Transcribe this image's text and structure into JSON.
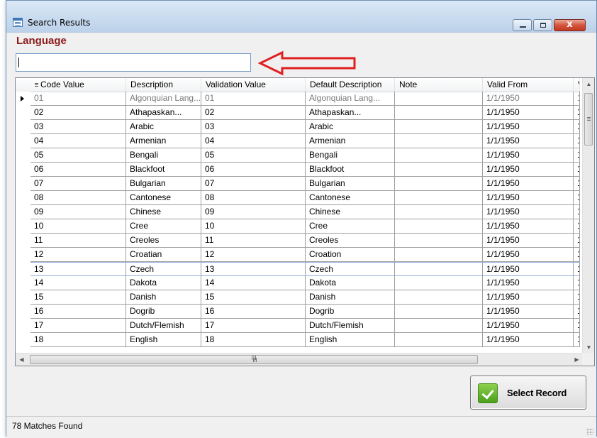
{
  "window": {
    "title": "Search Results",
    "close_glyph": "x"
  },
  "search": {
    "label": "Language",
    "value": "",
    "placeholder": ""
  },
  "grid": {
    "columns": [
      "Code Value",
      "Description",
      "Validation Value",
      "Default Description",
      "Note",
      "Valid From",
      "V"
    ],
    "rows": [
      [
        "01",
        "Algonquian Lang...",
        "01",
        "Algonquian Lang...",
        "",
        "1/1/1950",
        "1"
      ],
      [
        "02",
        "Athapaskan...",
        "02",
        "Athapaskan...",
        "",
        "1/1/1950",
        "1"
      ],
      [
        "03",
        "Arabic",
        "03",
        "Arabic",
        "",
        "1/1/1950",
        "1"
      ],
      [
        "04",
        "Armenian",
        "04",
        "Armenian",
        "",
        "1/1/1950",
        "1"
      ],
      [
        "05",
        "Bengali",
        "05",
        "Bengali",
        "",
        "1/1/1950",
        "1"
      ],
      [
        "06",
        "Blackfoot",
        "06",
        "Blackfoot",
        "",
        "1/1/1950",
        "1"
      ],
      [
        "07",
        "Bulgarian",
        "07",
        "Bulgarian",
        "",
        "1/1/1950",
        "1"
      ],
      [
        "08",
        "Cantonese",
        "08",
        "Cantonese",
        "",
        "1/1/1950",
        "1"
      ],
      [
        "09",
        "Chinese",
        "09",
        "Chinese",
        "",
        "1/1/1950",
        "1"
      ],
      [
        "10",
        "Cree",
        "10",
        "Cree",
        "",
        "1/1/1950",
        "1"
      ],
      [
        "11",
        "Creoles",
        "11",
        "Creoles",
        "",
        "1/1/1950",
        "1"
      ],
      [
        "12",
        "Croatian",
        "12",
        "Croation",
        "",
        "1/1/1950",
        "1"
      ],
      [
        "13",
        "Czech",
        "13",
        "Czech",
        "",
        "1/1/1950",
        "1"
      ],
      [
        "14",
        "Dakota",
        "14",
        "Dakota",
        "",
        "1/1/1950",
        "1"
      ],
      [
        "15",
        "Danish",
        "15",
        "Danish",
        "",
        "1/1/1950",
        "1"
      ],
      [
        "16",
        "Dogrib",
        "16",
        "Dogrib",
        "",
        "1/1/1950",
        "1"
      ],
      [
        "17",
        "Dutch/Flemish",
        "17",
        "Dutch/Flemish",
        "",
        "1/1/1950",
        "1"
      ],
      [
        "18",
        "English",
        "18",
        "English",
        "",
        "1/1/1950",
        "1"
      ]
    ],
    "selected_row": 0,
    "focused_row": 12,
    "scrollbar_glyph": "III"
  },
  "actions": {
    "select_label": "Select Record"
  },
  "status": {
    "matches": "78 Matches Found"
  },
  "colors": {
    "label": "#8b1a1a",
    "arrow": "#e02020",
    "check": "#5aad22"
  },
  "icons": [
    "window-icon",
    "minimize-icon",
    "maximize-icon",
    "close-icon",
    "row-pointer-icon",
    "red-arrow-icon",
    "checkmark-icon",
    "resize-grip-icon"
  ]
}
